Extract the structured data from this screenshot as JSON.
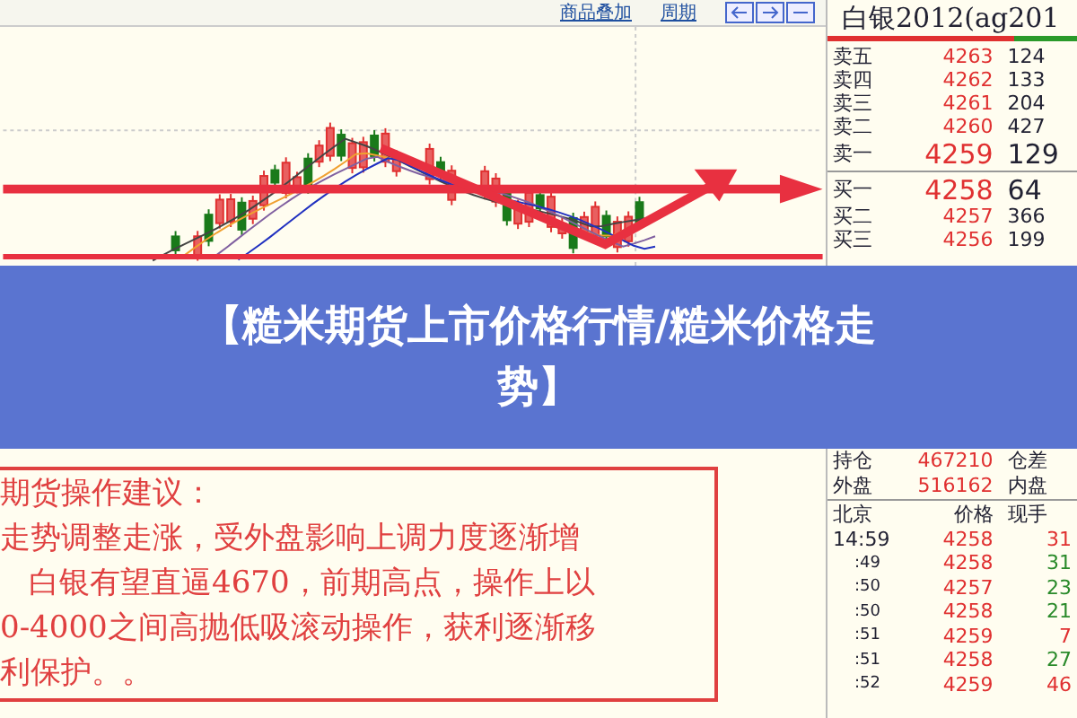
{
  "toolbar": {
    "links": [
      "商品叠加",
      "周期"
    ]
  },
  "quote": {
    "title": "白银2012(ag201",
    "asks": [
      {
        "label": "卖五",
        "price": "4263",
        "volume": "124"
      },
      {
        "label": "卖四",
        "price": "4262",
        "volume": "133"
      },
      {
        "label": "卖三",
        "price": "4261",
        "volume": "204"
      },
      {
        "label": "卖二",
        "price": "4260",
        "volume": "427"
      },
      {
        "label": "卖一",
        "price": "4259",
        "volume": "129"
      }
    ],
    "bids": [
      {
        "label": "买一",
        "price": "4258",
        "volume": "64"
      },
      {
        "label": "买二",
        "price": "4257",
        "volume": "366"
      },
      {
        "label": "买三",
        "price": "4256",
        "volume": "199"
      }
    ],
    "stats": [
      {
        "label": "持仓",
        "value": "467210",
        "label2": "仓差"
      },
      {
        "label": "外盘",
        "value": "516162",
        "label2": "内盘"
      }
    ],
    "ticks_header": [
      "北京",
      "价格",
      "现手"
    ],
    "ticks": [
      {
        "time": "14:59",
        "price": "4258",
        "volume": "31",
        "color": "#e03030"
      },
      {
        "time": ":49",
        "price": "4258",
        "volume": "31",
        "color": "#2a8a2a"
      },
      {
        "time": ":50",
        "price": "4257",
        "volume": "23",
        "color": "#2a8a2a"
      },
      {
        "time": ":50",
        "price": "4258",
        "volume": "21",
        "color": "#2a8a2a"
      },
      {
        "time": ":51",
        "price": "4259",
        "volume": "7",
        "color": "#e03030"
      },
      {
        "time": ":51",
        "price": "4258",
        "volume": "27",
        "color": "#2a8a2a"
      },
      {
        "time": ":52",
        "price": "4259",
        "volume": "46",
        "color": "#e03030"
      }
    ]
  },
  "note": {
    "lines": [
      "期货操作建议：",
      "走势调整走涨，受外盘影响上调力度逐渐增",
      "白银有望直逼4670，前期高点，操作上以",
      "0-4000之间高抛低吸滚动操作，获利逐渐移",
      "利保护。。"
    ]
  },
  "banner": {
    "title": "【糙米期货上市价格行情/糙米价格走势】"
  }
}
